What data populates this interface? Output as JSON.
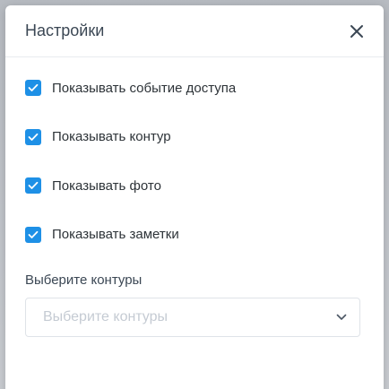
{
  "dialog": {
    "title": "Настройки",
    "close_icon": "close-icon"
  },
  "options": [
    {
      "label": "Показывать событие доступа",
      "checked": true
    },
    {
      "label": "Показывать контур",
      "checked": true
    },
    {
      "label": "Показывать фото",
      "checked": true
    },
    {
      "label": "Показывать заметки",
      "checked": true
    }
  ],
  "contours": {
    "label": "Выберите контуры",
    "placeholder": "Выберите контуры",
    "dropdown_icon": "chevron-down-icon"
  },
  "colors": {
    "accent": "#1e90e6",
    "title": "#3b4754",
    "placeholder": "#c5cbd3"
  }
}
